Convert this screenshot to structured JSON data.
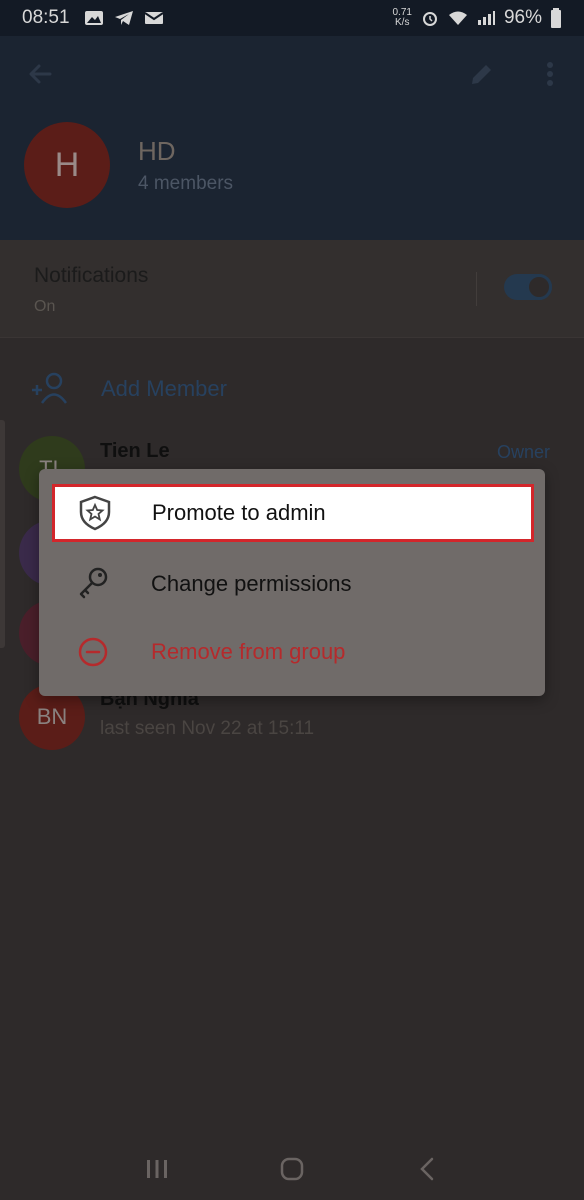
{
  "status_bar": {
    "time": "08:51",
    "net_speed_value": "0.71",
    "net_speed_unit": "K/s",
    "battery": "96%"
  },
  "header": {
    "group_initial": "H",
    "group_name": "HD",
    "member_count": "4 members",
    "icons": [
      "back-arrow-icon",
      "pencil-icon",
      "more-vert-icon"
    ]
  },
  "notifications": {
    "title": "Notifications",
    "status": "On",
    "enabled": true
  },
  "add_member": {
    "label": "Add Member"
  },
  "members": [
    {
      "initials": "TL",
      "name": "Tien Le",
      "status": "",
      "role": "Owner",
      "color": "#2f3b1c"
    },
    {
      "initials": "",
      "name": "",
      "status": "",
      "role": "",
      "color": "#3a2a4a"
    },
    {
      "initials": "",
      "name": "",
      "status": "",
      "role": "",
      "color": "#4a1f2a"
    },
    {
      "initials": "BN",
      "name": "Bạn Nghĩa",
      "status": "last seen Nov 22 at 15:11",
      "role": "",
      "color": "#5b1d18"
    }
  ],
  "menu": {
    "items": [
      {
        "label": "Promote to admin",
        "icon": "shield-star-icon",
        "highlighted": true
      },
      {
        "label": "Change permissions",
        "icon": "key-icon"
      },
      {
        "label": "Remove from group",
        "icon": "minus-circle-icon",
        "color": "#b52a2c"
      }
    ]
  },
  "colors": {
    "accent": "#27415f",
    "danger": "#b52a2c",
    "highlight_border": "#d3262b"
  }
}
